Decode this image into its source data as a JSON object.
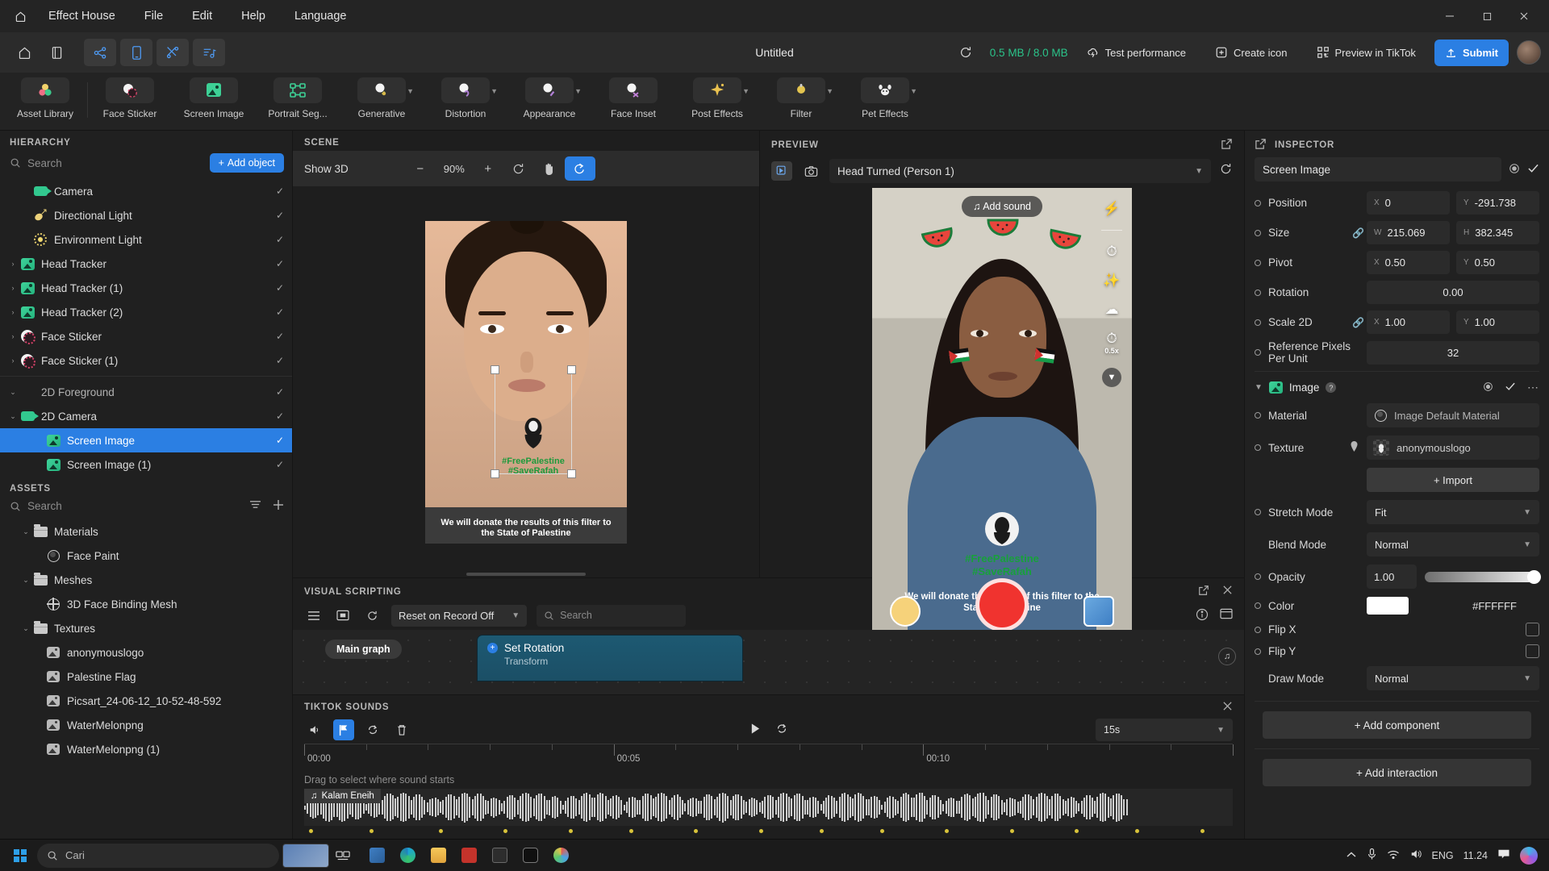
{
  "menubar": {
    "home_icon": "home-icon",
    "items": [
      "Effect House",
      "File",
      "Edit",
      "Help",
      "Language"
    ],
    "window_controls": {
      "minimize": "─",
      "maximize": "☐",
      "close": "✕"
    }
  },
  "actionbar": {
    "left_icons": [
      "home-icon",
      "library-icon",
      "graph-icon",
      "phone-icon",
      "tools-icon",
      "audio-icon"
    ],
    "doc_title": "Untitled",
    "refresh_icon": "refresh-icon",
    "memory": "0.5 MB / 8.0 MB",
    "test_performance": "Test performance",
    "create_icon_label": "Create icon",
    "preview_tiktok": "Preview in TikTok",
    "submit": "Submit"
  },
  "toolbar": {
    "items": [
      {
        "label": "Asset Library",
        "icon": "asset-library-icon",
        "chevron": false
      },
      {
        "label": "Face Sticker",
        "icon": "face-sticker-icon",
        "chevron": false
      },
      {
        "label": "Screen Image",
        "icon": "screen-image-icon",
        "chevron": false
      },
      {
        "label": "Portrait Seg...",
        "icon": "portrait-segmentation-icon",
        "chevron": false
      },
      {
        "label": "Generative",
        "icon": "generative-icon",
        "chevron": true
      },
      {
        "label": "Distortion",
        "icon": "distortion-icon",
        "chevron": true
      },
      {
        "label": "Appearance",
        "icon": "appearance-icon",
        "chevron": true
      },
      {
        "label": "Face Inset",
        "icon": "face-inset-icon",
        "chevron": false
      },
      {
        "label": "Post Effects",
        "icon": "post-effects-icon",
        "chevron": true
      },
      {
        "label": "Filter",
        "icon": "filter-icon",
        "chevron": true
      },
      {
        "label": "Pet Effects",
        "icon": "pet-effects-icon",
        "chevron": true
      }
    ]
  },
  "hierarchy": {
    "title": "HIERARCHY",
    "search_placeholder": "Search",
    "add_object": "Add object",
    "items": [
      {
        "label": "Camera",
        "icon": "camera-icon",
        "arrow": "",
        "checked": true,
        "indent": 1,
        "selected": false
      },
      {
        "label": "Directional Light",
        "icon": "directional-light-icon",
        "arrow": "",
        "checked": true,
        "indent": 1,
        "selected": false
      },
      {
        "label": "Environment Light",
        "icon": "environment-light-icon",
        "arrow": "",
        "checked": true,
        "indent": 1,
        "selected": false
      },
      {
        "label": "Head Tracker",
        "icon": "image-icon",
        "arrow": "›",
        "checked": true,
        "indent": 0,
        "selected": false
      },
      {
        "label": "Head Tracker (1)",
        "icon": "image-icon",
        "arrow": "›",
        "checked": true,
        "indent": 0,
        "selected": false
      },
      {
        "label": "Head Tracker (2)",
        "icon": "image-icon",
        "arrow": "›",
        "checked": true,
        "indent": 0,
        "selected": false
      },
      {
        "label": "Face Sticker",
        "icon": "sticker-icon",
        "arrow": "›",
        "checked": true,
        "indent": 0,
        "selected": false
      },
      {
        "label": "Face Sticker (1)",
        "icon": "sticker-icon",
        "arrow": "›",
        "checked": true,
        "indent": 0,
        "selected": false
      }
    ],
    "group_items": [
      {
        "label": "2D Foreground",
        "icon": "",
        "arrow": "⌄",
        "checked": true,
        "indent": 0,
        "selected": false
      },
      {
        "label": "2D Camera",
        "icon": "camera-icon",
        "arrow": "⌄",
        "checked": true,
        "indent": 0,
        "selected": false
      },
      {
        "label": "Screen Image",
        "icon": "image-icon",
        "arrow": "",
        "checked": true,
        "indent": 2,
        "selected": true
      },
      {
        "label": "Screen Image (1)",
        "icon": "image-icon",
        "arrow": "",
        "checked": true,
        "indent": 2,
        "selected": false
      }
    ]
  },
  "assets": {
    "title": "ASSETS",
    "search_placeholder": "Search",
    "filter_icon": "filter-icon",
    "add_icon": "plus-icon",
    "tree": [
      {
        "label": "Materials",
        "type": "folder",
        "arrow": "⌄",
        "indent": 1
      },
      {
        "label": "Face Paint",
        "type": "material",
        "arrow": "",
        "indent": 2
      },
      {
        "label": "Meshes",
        "type": "folder",
        "arrow": "⌄",
        "indent": 1
      },
      {
        "label": "3D Face Binding Mesh",
        "type": "mesh",
        "arrow": "",
        "indent": 2
      },
      {
        "label": "Textures",
        "type": "folder",
        "arrow": "⌄",
        "indent": 1
      },
      {
        "label": "anonymouslogo",
        "type": "texture",
        "arrow": "",
        "indent": 2
      },
      {
        "label": "Palestine Flag",
        "type": "texture",
        "arrow": "",
        "indent": 2
      },
      {
        "label": "Picsart_24-06-12_10-52-48-592",
        "type": "texture",
        "arrow": "",
        "indent": 2
      },
      {
        "label": "WaterMelonpng",
        "type": "texture",
        "arrow": "",
        "indent": 2
      },
      {
        "label": "WaterMelonpng (1)",
        "type": "texture",
        "arrow": "",
        "indent": 2
      }
    ]
  },
  "scene": {
    "title": "SCENE",
    "show_3d": "Show 3D",
    "zoom": "90%",
    "minus": "−",
    "plus": "+",
    "reset_icon": "reset-icon",
    "pan_icon": "hand-icon",
    "orbit_icon": "orbit-icon",
    "overlay_green_text": "#FreePalestine\n#SaveRafah",
    "caption": "We will donate the results of this filter to the State of Palestine"
  },
  "preview": {
    "title": "PREVIEW",
    "open_icon": "open-external-icon",
    "record_icon": "record-icon",
    "camera_icon": "camera-icon",
    "selected_scenario": "Head Turned (Person 1)",
    "refresh_icon": "refresh-icon",
    "add_sound": "Add sound",
    "rail_icons": [
      "flash-icon",
      "timer-icon",
      "magic-icon",
      "beauty-icon",
      "speed-icon",
      "chevron-down-icon"
    ],
    "speed_label": "0.5x",
    "green_text_line1": "#FreePalestine",
    "green_text_line2": "#SaveRafah",
    "donate_text": "We will donate the results of this filter to the State of Palestine",
    "footer_icons": [
      "tiktok-note-icon",
      "volume-icon",
      "pause-icon",
      "step-forward-icon",
      "fullscreen-icon",
      "record-dot-icon"
    ]
  },
  "visual_scripting": {
    "title": "VISUAL SCRIPTING",
    "open_icon": "open-external-icon",
    "close_icon": "close-icon",
    "menu_icon": "hamburger-icon",
    "panel_icon": "panel-icon",
    "reset_icon": "refresh-icon",
    "record_mode": "Reset on Record Off",
    "search_placeholder": "Search",
    "info_icon": "info-icon",
    "window_icon": "window-icon",
    "graph_tab": "Main graph",
    "node": {
      "title": "Set Rotation",
      "subtitle": "Transform"
    }
  },
  "tiktok_sounds": {
    "title": "TIKTOK SOUNDS",
    "close_icon": "close-icon",
    "volume_icon": "volume-icon",
    "marker_icon": "flag-icon",
    "loop_icon": "loop-icon",
    "delete_icon": "trash-icon",
    "play_icon": "play-icon",
    "repeat_icon": "repeat-icon",
    "duration": "15s",
    "ruler_labels": [
      "00:00",
      "00:05",
      "00:10"
    ],
    "hint": "Drag to select where sound starts",
    "sound_name": "Kalam Eneih"
  },
  "inspector": {
    "title": "INSPECTOR",
    "open_icon": "open-external-icon",
    "refresh_icon": "refresh-icon",
    "object_name": "Screen Image",
    "transform": [
      {
        "label": "Position",
        "link": false,
        "fields": [
          {
            "prefix": "X",
            "value": "0"
          },
          {
            "prefix": "Y",
            "value": "-291.738"
          }
        ]
      },
      {
        "label": "Size",
        "link": true,
        "fields": [
          {
            "prefix": "W",
            "value": "215.069"
          },
          {
            "prefix": "H",
            "value": "382.345"
          }
        ]
      },
      {
        "label": "Pivot",
        "link": false,
        "fields": [
          {
            "prefix": "X",
            "value": "0.50"
          },
          {
            "prefix": "Y",
            "value": "0.50"
          }
        ]
      },
      {
        "label": "Rotation",
        "link": false,
        "fields": [
          {
            "prefix": "",
            "value": "0.00"
          }
        ]
      },
      {
        "label": "Scale 2D",
        "link": true,
        "fields": [
          {
            "prefix": "X",
            "value": "1.00"
          },
          {
            "prefix": "Y",
            "value": "1.00"
          }
        ]
      },
      {
        "label": "Reference Pixels Per Unit",
        "link": false,
        "fields": [
          {
            "prefix": "",
            "value": "32"
          }
        ]
      }
    ],
    "component": {
      "name": "Image",
      "help_icon": "help-icon",
      "more_icon": "more-icon",
      "material_label": "Material",
      "material_value": "Image Default Material",
      "texture_label": "Texture",
      "texture_value": "anonymouslogo",
      "import": "+ Import",
      "stretch_mode_label": "Stretch Mode",
      "stretch_mode_value": "Fit",
      "blend_mode_label": "Blend Mode",
      "blend_mode_value": "Normal",
      "opacity_label": "Opacity",
      "opacity_value": "1.00",
      "color_label": "Color",
      "color_hex": "#FFFFFF",
      "flip_x_label": "Flip X",
      "flip_y_label": "Flip Y",
      "draw_mode_label": "Draw Mode",
      "draw_mode_value": "Normal"
    },
    "add_component": "+ Add component",
    "add_interaction": "+ Add interaction"
  },
  "taskbar": {
    "start_icon": "windows-icon",
    "search_placeholder": "Cari",
    "task_view_icon": "task-view-icon",
    "apps": [
      "widgets-icon",
      "edge-icon",
      "explorer-icon",
      "office-icon",
      "tv-icon",
      "effecthouse-icon",
      "paint-icon"
    ],
    "tray": {
      "chevron": "chevron-up-icon",
      "mic": "mic-icon",
      "wifi": "wifi-icon",
      "volume": "volume-icon",
      "lang": "ENG",
      "time": "11.24",
      "notify": "notification-icon",
      "copilot": "copilot-icon"
    }
  },
  "colors": {
    "accent": "#2b7fe3",
    "memory_green": "#2bc48a",
    "node_blue": "#1d5972",
    "palestine_green": "#169b49",
    "shutter_red": "#f0332f"
  }
}
